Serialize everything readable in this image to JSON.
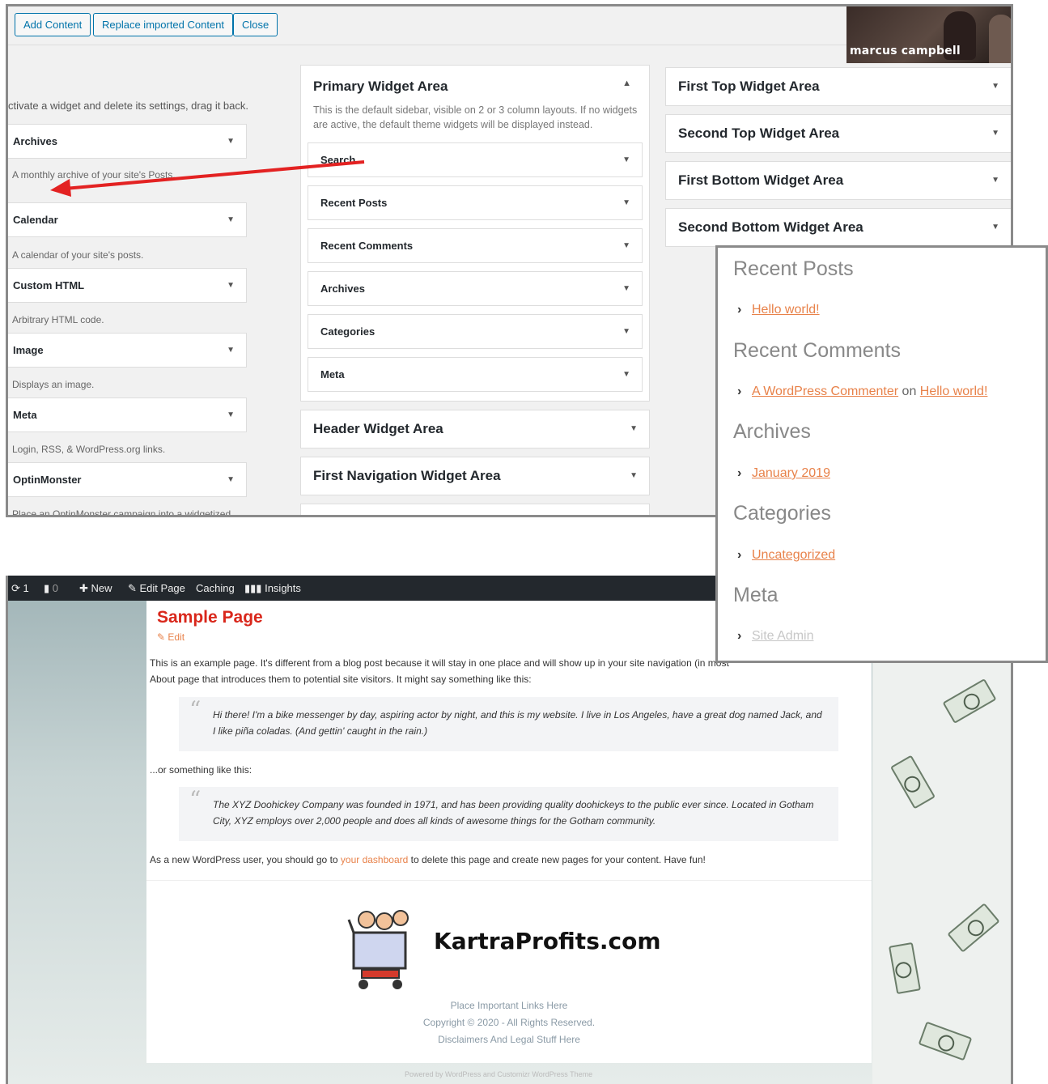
{
  "toolbar": {
    "add_label": "Add Content",
    "replace_label": "Replace imported Content",
    "close_label": "Close"
  },
  "video": {
    "name": "marcus campbell"
  },
  "available": {
    "hint": "ctivate a widget and delete its settings, drag it back.",
    "items": [
      {
        "label": "Archives",
        "desc": "A monthly archive of your site's Posts."
      },
      {
        "label": "Calendar",
        "desc": "A calendar of your site's posts."
      },
      {
        "label": "Custom HTML",
        "desc": "Arbitrary HTML code."
      },
      {
        "label": "Image",
        "desc": "Displays an image."
      },
      {
        "label": "Meta",
        "desc": "Login, RSS, & WordPress.org links."
      },
      {
        "label": "OptinMonster",
        "desc": "Place an OptinMonster campaign into a widgetized"
      }
    ]
  },
  "primary": {
    "title": "Primary Widget Area",
    "desc": "This is the default sidebar, visible on 2 or 3 column layouts. If no widgets are active, the default theme widgets will be displayed instead.",
    "widgets": [
      "Search",
      "Recent Posts",
      "Recent Comments",
      "Archives",
      "Categories",
      "Meta"
    ]
  },
  "areas_mid": [
    "Header Widget Area",
    "First Navigation Widget Area"
  ],
  "areas_right": [
    "First Top Widget Area",
    "Second Top Widget Area",
    "First Bottom Widget Area",
    "Second Bottom Widget Area"
  ],
  "preview": {
    "recent_posts": "Recent Posts",
    "hello": "Hello world!",
    "recent_comments": "Recent Comments",
    "commenter": "A WordPress Commenter",
    "on": "on",
    "hello2": "Hello world!",
    "archives": "Archives",
    "jan": "January 2019",
    "categories": "Categories",
    "uncat": "Uncategorized",
    "meta": "Meta",
    "site_admin": "Site Admin"
  },
  "adminbar": {
    "updates": "1",
    "comments": "0",
    "new": "New",
    "edit_page": "Edit Page",
    "caching": "Caching",
    "insights": "Insights"
  },
  "page": {
    "title": "Sample Page",
    "edit": "Edit",
    "p1": "This is an example page. It's different from a blog post because it will stay in one place and will show up in your site navigation (in most",
    "p1b": "About page that introduces them to potential site visitors. It might say something like this:",
    "q1": "Hi there! I'm a bike messenger by day, aspiring actor by night, and this is my website. I live in Los Angeles, have a great dog named Jack, and I like piña coladas. (And gettin' caught in the rain.)",
    "p2": "...or something like this:",
    "q2": "The XYZ Doohickey Company was founded in 1971, and has been providing quality doohickeys to the public ever since. Located in Gotham City, XYZ employs over 2,000 people and does all kinds of awesome things for the Gotham community.",
    "p3a": "As a new WordPress user, you should go to ",
    "p3link": "your dashboard",
    "p3b": " to delete this page and create new pages for your content. Have fun!"
  },
  "footer": {
    "logo": "KartraProfits.com",
    "links": "Place Important Links Here",
    "copyright": "Copyright © 2020 - All Rights Reserved.",
    "legal": "Disclaimers And Legal Stuff Here",
    "powered": "Powered by WordPress and Customizr WordPress Theme"
  },
  "colors": {
    "accent": "#0073aa",
    "link": "#e8824a",
    "title_red": "#d9271b",
    "arrow_red": "#e32222"
  }
}
